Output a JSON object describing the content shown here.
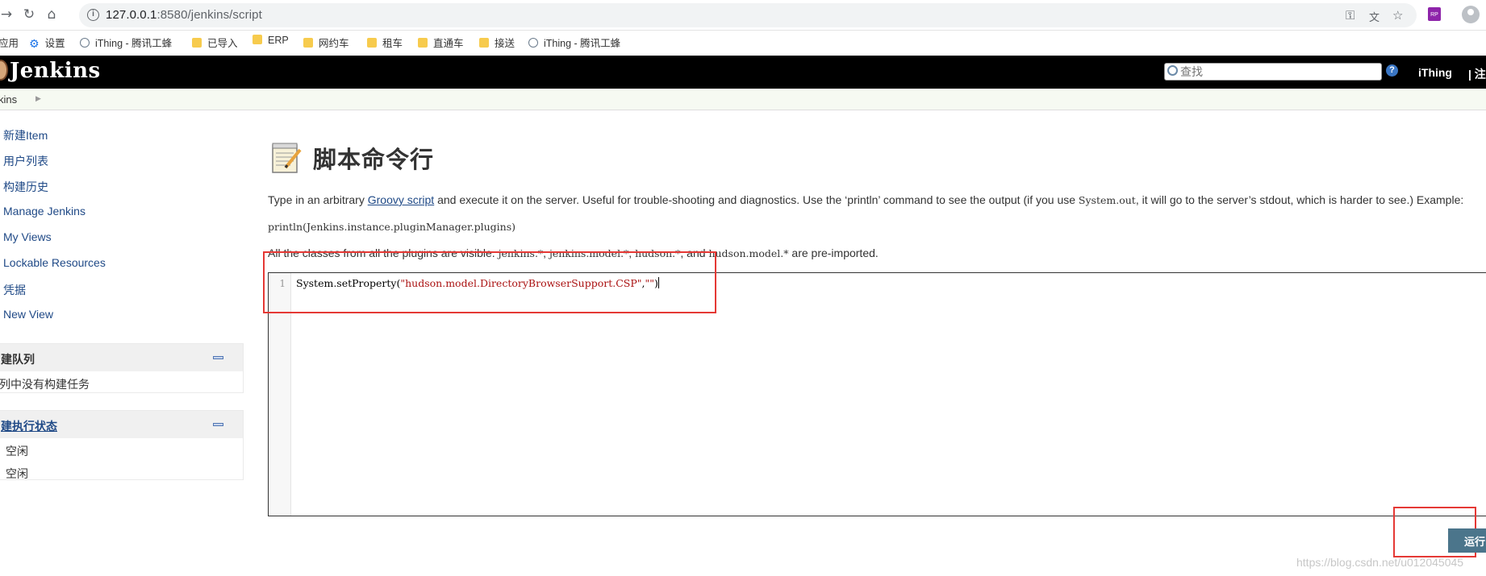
{
  "browser": {
    "url_host": "127.0.0.1",
    "url_rest": ":8580/jenkins/script",
    "bookmarks": [
      {
        "label": "应用",
        "icon": "apps-icon"
      },
      {
        "label": "设置",
        "icon": "gear-icon"
      },
      {
        "label": "iThing - 腾讯工蜂",
        "icon": "globe-icon"
      },
      {
        "label": "已导入",
        "icon": "folder-icon"
      },
      {
        "label": "ERP",
        "icon": "folder-icon"
      },
      {
        "label": "网约车",
        "icon": "folder-icon"
      },
      {
        "label": "租车",
        "icon": "folder-icon"
      },
      {
        "label": "直通车",
        "icon": "folder-icon"
      },
      {
        "label": "接送",
        "icon": "folder-icon"
      },
      {
        "label": "iThing - 腾讯工蜂",
        "icon": "globe-icon"
      }
    ]
  },
  "header": {
    "title": "Jenkins",
    "search_placeholder": "查找",
    "user": "iThing",
    "logout": "| 注"
  },
  "breadcrumb": {
    "root": "kins"
  },
  "sidebar": {
    "tasks": [
      "新建Item",
      "用户列表",
      "构建历史",
      "Manage Jenkins",
      "My Views",
      "Lockable Resources",
      "凭据",
      "New View"
    ],
    "queue": {
      "title": "建队列",
      "empty": "列中没有构建任务"
    },
    "executors": {
      "title": "建执行状态",
      "rows": [
        "空闲",
        "空闲"
      ]
    }
  },
  "main": {
    "title": "脚本命令行",
    "desc_before": "Type in an arbitrary ",
    "desc_link": "Groovy script",
    "desc_middle": " and execute it on the server. Useful for trouble-shooting and diagnostics. Use the ‘println’ command to see the output (if you use ",
    "desc_code": "System.out",
    "desc_after": ", it will go to the server’s stdout, which is harder to see.) Example:",
    "example": "println(Jenkins.instance.pluginManager.plugins)",
    "preimport": {
      "p1": "All the classes from all the plugins are visible. ",
      "c1": "jenkins.*",
      "s1": ", ",
      "c2": "jenkins.model.*",
      "s2": ", ",
      "c3": "hudson.*",
      "s3": ", and ",
      "c4": "hudson.model.*",
      "p2": " are pre-imported."
    },
    "editor": {
      "line_number": "1",
      "code_prefix": "System.setProperty(",
      "code_string1": "\"hudson.model.DirectoryBrowserSupport.CSP\"",
      "code_sep": ",",
      "code_string2": "\"\"",
      "code_suffix": ")"
    },
    "run_button": "运行"
  },
  "watermark": "https://blog.csdn.net/u012045045"
}
